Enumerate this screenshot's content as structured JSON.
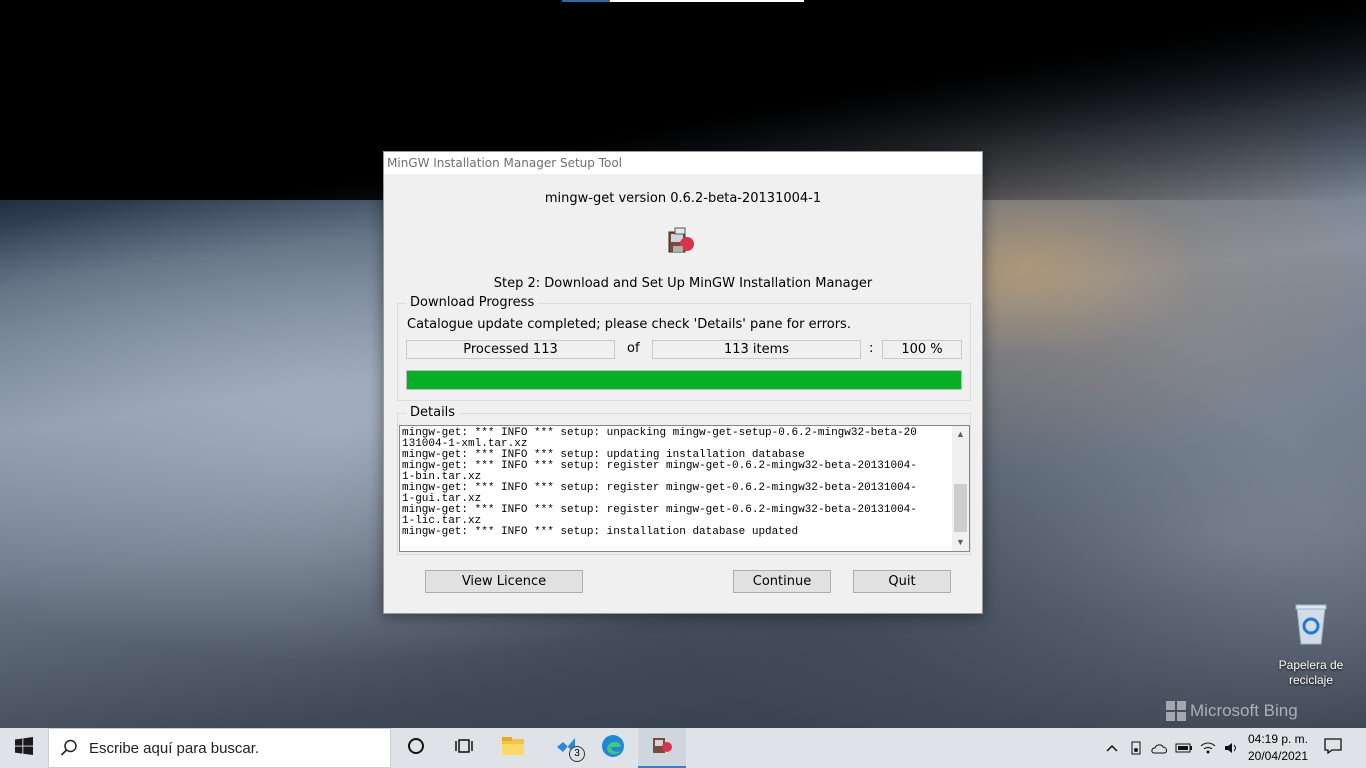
{
  "dialog": {
    "title": "MinGW Installation Manager Setup Tool",
    "version": "mingw-get version 0.6.2-beta-20131004-1",
    "step": "Step 2: Download and Set Up MinGW Installation Manager",
    "progress_group_label": "Download Progress",
    "status": "Catalogue update completed; please check 'Details' pane for errors.",
    "processed": "Processed 113",
    "of_label": "of",
    "total": "113 items",
    "colon": ":",
    "percent": "100 %",
    "progress_fraction": 1.0,
    "details_group_label": "Details",
    "log": [
      "mingw-get: *** INFO *** setup: unpacking mingw-get-setup-0.6.2-mingw32-beta-20",
      "131004-1-xml.tar.xz",
      "mingw-get: *** INFO *** setup: updating installation database",
      "mingw-get: *** INFO *** setup: register mingw-get-0.6.2-mingw32-beta-20131004-",
      "1-bin.tar.xz",
      "mingw-get: *** INFO *** setup: register mingw-get-0.6.2-mingw32-beta-20131004-",
      "1-gui.tar.xz",
      "mingw-get: *** INFO *** setup: register mingw-get-0.6.2-mingw32-beta-20131004-",
      "1-lic.tar.xz",
      "mingw-get: *** INFO *** setup: installation database updated"
    ],
    "buttons": {
      "view_licence": "View Licence",
      "continue": "Continue",
      "quit": "Quit"
    }
  },
  "desktop": {
    "recycle_bin_label": "Papelera de reciclaje",
    "watermark": "Microsoft Bing"
  },
  "taskbar": {
    "search_placeholder": "Escribe aquí para buscar.",
    "vscode_badge": "3",
    "time": "04:19 p. m.",
    "date": "20/04/2021",
    "accent_color": "#3a7bd5"
  },
  "icons": [
    "windows-start-icon",
    "search-icon",
    "cortana-icon",
    "task-view-icon",
    "file-explorer-icon",
    "vscode-icon",
    "edge-icon",
    "mingw-icon",
    "recycle-bin-icon"
  ]
}
